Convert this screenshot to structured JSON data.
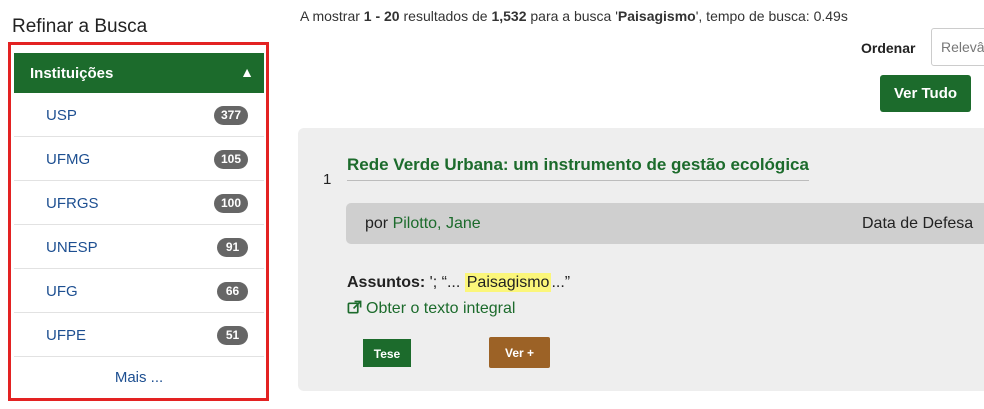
{
  "sidebar": {
    "title": "Refinar a Busca",
    "facet": {
      "label": "Instituições",
      "toggle_glyph": "▲",
      "items": [
        {
          "name": "USP",
          "count": "377"
        },
        {
          "name": "UFMG",
          "count": "105"
        },
        {
          "name": "UFRGS",
          "count": "100"
        },
        {
          "name": "UNESP",
          "count": "91"
        },
        {
          "name": "UFG",
          "count": "66"
        },
        {
          "name": "UFPE",
          "count": "51"
        }
      ],
      "more_label": "Mais ..."
    }
  },
  "summary": {
    "prefix": "A mostrar ",
    "range": "1 - 20",
    "mid": " resultados de ",
    "total": "1,532",
    "for_search": " para a busca '",
    "query": "Paisagismo",
    "suffix": "', tempo de busca: 0.49s"
  },
  "sort": {
    "label": "Ordenar",
    "value": "Relevância"
  },
  "view_all_label": "Ver Tudo",
  "result": {
    "number": "1",
    "title": "Rede Verde Urbana: um instrumento de gestão ecológica",
    "by_label": "por ",
    "author": "Pilotto, Jane",
    "date_label": "Data de Defesa",
    "subjects_label": "Assuntos:",
    "subjects_pre": " '; “...",
    "subjects_highlight": "Paisagismo",
    "subjects_post": "...”",
    "fulltext_label": "Obter o texto integral",
    "type_label": "Tese",
    "more_label": "Ver +"
  },
  "colors": {
    "brand_green": "#1c6b2c",
    "frame_red": "#e32222",
    "link_blue": "#1d4f91",
    "badge_gray": "#666666",
    "highlight": "#fbf67a",
    "brown_button": "#9c6226"
  },
  "icons": [
    "collapse-triangle-icon",
    "external-link-icon"
  ]
}
